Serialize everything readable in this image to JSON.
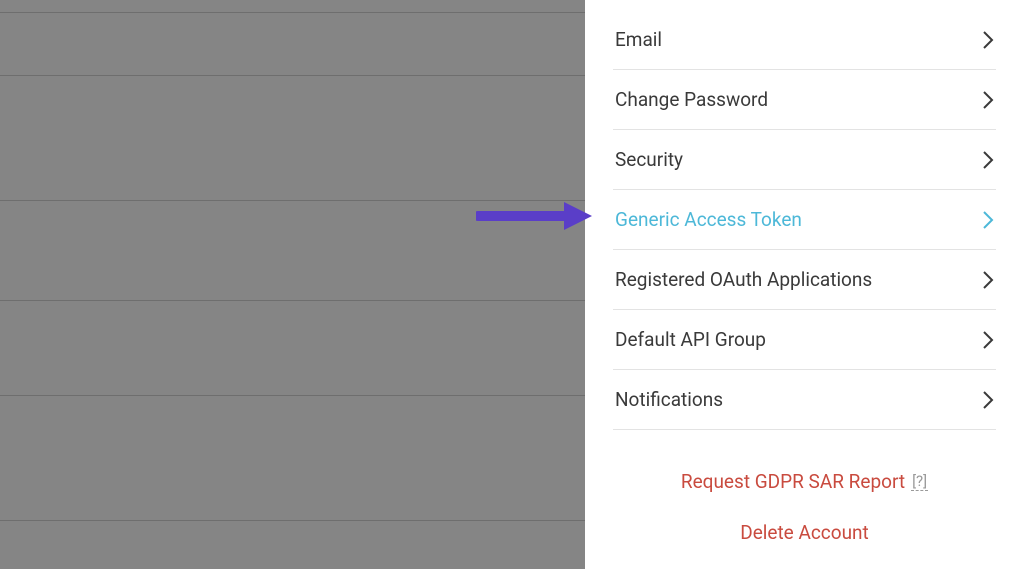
{
  "menu": {
    "items": [
      {
        "label": "Email",
        "highlighted": false
      },
      {
        "label": "Change Password",
        "highlighted": false
      },
      {
        "label": "Security",
        "highlighted": false
      },
      {
        "label": "Generic Access Token",
        "highlighted": true
      },
      {
        "label": "Registered OAuth Applications",
        "highlighted": false
      },
      {
        "label": "Default API Group",
        "highlighted": false
      },
      {
        "label": "Notifications",
        "highlighted": false
      }
    ]
  },
  "actions": {
    "gdpr_label": "Request GDPR SAR Report",
    "gdpr_help": "[?]",
    "delete_label": "Delete Account"
  },
  "colors": {
    "highlight": "#4db8d8",
    "danger": "#c94b3f",
    "arrow": "#5a3ec8"
  }
}
